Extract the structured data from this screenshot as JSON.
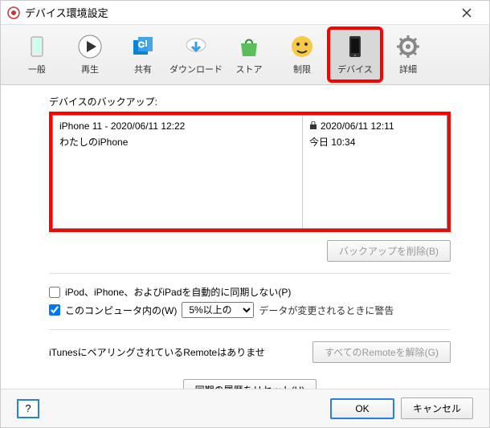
{
  "title": "デバイス環境設定",
  "tabs": [
    {
      "label": "一般"
    },
    {
      "label": "再生"
    },
    {
      "label": "共有"
    },
    {
      "label": "ダウンロード"
    },
    {
      "label": "ストア"
    },
    {
      "label": "制限"
    },
    {
      "label": "デバイス"
    },
    {
      "label": "詳細"
    }
  ],
  "section": {
    "backups_label": "デバイスのバックアップ:"
  },
  "backups": {
    "left": [
      {
        "label": "iPhone 11 - 2020/06/11 12:22"
      },
      {
        "label": "わたしのiPhone"
      }
    ],
    "right": [
      {
        "label": "2020/06/11 12:11",
        "locked": true
      },
      {
        "label": "今日 10:34"
      }
    ]
  },
  "buttons": {
    "delete_backup": "バックアップを削除(B)",
    "remove_remotes": "すべてのRemoteを解除(G)",
    "reset_sync": "同期の履歴をリセット(H)",
    "ok": "OK",
    "cancel": "キャンセル",
    "help": "?"
  },
  "options": {
    "no_auto_sync": "iPod、iPhone、およびiPadを自動的に同期しない(P)",
    "warn_prefix": "このコンピュータ内の(W)",
    "warn_suffix": "データが変更されるときに警告",
    "percent_selected": "5%以上の"
  },
  "remote": {
    "text": "iTunesにペアリングされているRemoteはありませ"
  }
}
